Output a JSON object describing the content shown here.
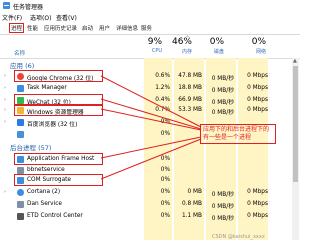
{
  "window": {
    "title": "任务管理器"
  },
  "menu": [
    {
      "label": "文件(F)"
    },
    {
      "label": "选项(O)"
    },
    {
      "label": "查看(V)"
    }
  ],
  "tabs": [
    {
      "label": "进程"
    },
    {
      "label": "性能"
    },
    {
      "label": "应用历史记录"
    },
    {
      "label": "启动"
    },
    {
      "label": "用户"
    },
    {
      "label": "详细信息"
    },
    {
      "label": "服务"
    }
  ],
  "columns": {
    "name": {
      "label": "名称"
    },
    "cpu": {
      "pct": "9%",
      "label": "CPU"
    },
    "memory": {
      "pct": "46%",
      "label": "内存"
    },
    "disk": {
      "pct": "0%",
      "label": "磁盘"
    },
    "network": {
      "pct": "0%",
      "label": "网络"
    }
  },
  "sections": {
    "apps": "应用 (6)",
    "background": "后台进程 (57)"
  },
  "rows": [
    {
      "name": "Google Chrome (32 位)",
      "cpu": "0.6%",
      "mem": "47.8 MB",
      "disk": "0 MB/秒",
      "net": "0 Mbps",
      "icon": "chrome-icon",
      "color": "#e8453c"
    },
    {
      "name": "Task Manager",
      "cpu": "1.2%",
      "mem": "18.8 MB",
      "disk": "0 MB/秒",
      "net": "0 Mbps",
      "icon": "task-manager-icon",
      "color": "#3c8dde"
    },
    {
      "name": "WeChat (32 位)",
      "cpu": "0.4%",
      "mem": "66.9 MB",
      "disk": "0 MB/秒",
      "net": "0 Mbps",
      "icon": "wechat-icon",
      "color": "#2dbb4e"
    },
    {
      "name": "Windows 资源管理器",
      "cpu": "0.7%",
      "mem": "53.3 MB",
      "disk": "0 MB/秒",
      "net": "0 Mbps",
      "icon": "explorer-icon",
      "color": "#f2b431"
    },
    {
      "name": "百度浏览器 (32 位)",
      "cpu": "0%",
      "mem": "",
      "disk": "",
      "net": "",
      "icon": "baidu-browser-icon",
      "color": "#2d7be6"
    },
    {
      "name": "",
      "cpu": "0%",
      "mem": "",
      "disk": "",
      "net": "",
      "icon": "app-icon",
      "color": "#4a90d9"
    },
    {
      "name": "Application Frame Host",
      "cpu": "0%",
      "mem": "",
      "disk": "",
      "net": "",
      "icon": "frame-host-icon",
      "color": "#3c8dde"
    },
    {
      "name": "bbnetservice",
      "cpu": "0%",
      "mem": "",
      "disk": "",
      "net": "",
      "icon": "service-icon",
      "color": "#7f8fa6"
    },
    {
      "name": "COM Surrogate",
      "cpu": "0%",
      "mem": "",
      "disk": "",
      "net": "",
      "icon": "com-surrogate-icon",
      "color": "#3c8dde"
    },
    {
      "name": "Cortana (2)",
      "cpu": "0%",
      "mem": "0 MB",
      "disk": "0 MB/秒",
      "net": "0 Mbps",
      "icon": "cortana-icon",
      "color": "#3c8dde"
    },
    {
      "name": "Dan Service",
      "cpu": "0%",
      "mem": "0.8 MB",
      "disk": "0 MB/秒",
      "net": "0 Mbps",
      "icon": "dan-service-icon",
      "color": "#7f8fa6"
    },
    {
      "name": "ETD Control Center",
      "cpu": "0%",
      "mem": "1.1 MB",
      "disk": "0 MB/秒",
      "net": "0 Mbps",
      "icon": "etd-icon",
      "color": "#555555"
    }
  ],
  "annotation": "应用下的和后台进程下的有一些是一个进程",
  "watermark": "CSDN @kaishui_xxxx"
}
